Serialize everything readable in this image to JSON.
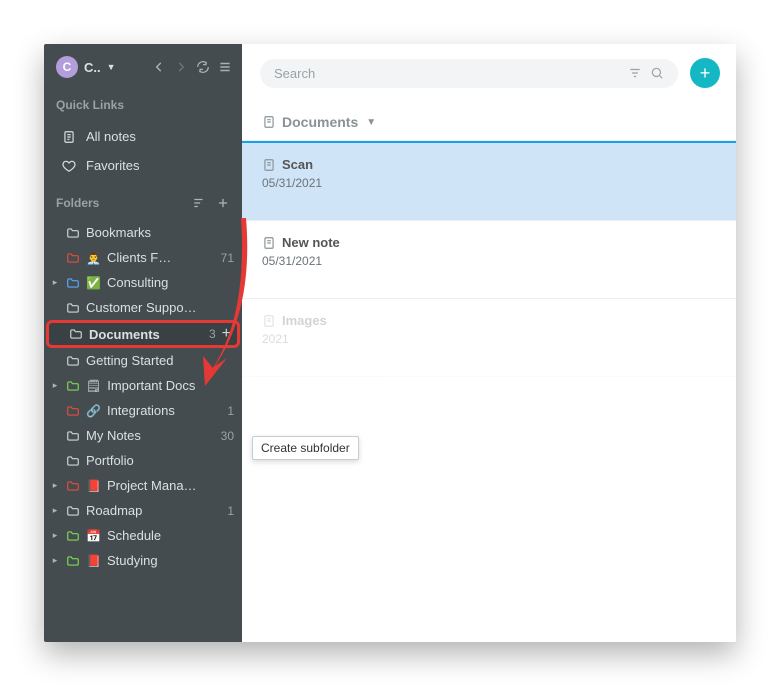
{
  "user": {
    "initial": "C",
    "name": "C.."
  },
  "quick_links": {
    "section_title": "Quick Links",
    "all_notes": "All notes",
    "favorites": "Favorites"
  },
  "folders_section": {
    "title": "Folders"
  },
  "folders": [
    {
      "label": "Bookmarks",
      "color": "#cfd6d9",
      "count": "",
      "expandable": false,
      "emoji": "",
      "highlight": false
    },
    {
      "label": "Clients F…",
      "color": "#e74c3c",
      "count": "71",
      "expandable": false,
      "emoji": "👨‍💼",
      "highlight": false
    },
    {
      "label": "Consulting",
      "color": "#56a8ff",
      "count": "",
      "expandable": true,
      "emoji": "✅",
      "highlight": false
    },
    {
      "label": "Customer Suppo…",
      "color": "#cfd6d9",
      "count": "",
      "expandable": false,
      "emoji": "",
      "highlight": false
    },
    {
      "label": "Documents",
      "color": "#cfd6d9",
      "count": "3",
      "expandable": false,
      "emoji": "",
      "highlight": true,
      "active": true
    },
    {
      "label": "Getting Started",
      "color": "#cfd6d9",
      "count": "",
      "expandable": false,
      "emoji": "",
      "highlight": false
    },
    {
      "label": "Important Docs",
      "color": "#7ed957",
      "count": "",
      "expandable": true,
      "emoji": "🗒",
      "highlight": false
    },
    {
      "label": "Integrations",
      "color": "#e74c3c",
      "count": "1",
      "expandable": false,
      "emoji": "🔗",
      "highlight": false
    },
    {
      "label": "My Notes",
      "color": "#cfd6d9",
      "count": "30",
      "expandable": false,
      "emoji": "",
      "highlight": false
    },
    {
      "label": "Portfolio",
      "color": "#cfd6d9",
      "count": "",
      "expandable": false,
      "emoji": "",
      "highlight": false
    },
    {
      "label": "Project Mana…",
      "color": "#e74c3c",
      "count": "",
      "expandable": true,
      "emoji": "📕",
      "highlight": false
    },
    {
      "label": "Roadmap",
      "color": "#cfd6d9",
      "count": "1",
      "expandable": true,
      "emoji": "",
      "highlight": false
    },
    {
      "label": "Schedule",
      "color": "#7ed957",
      "count": "",
      "expandable": true,
      "emoji": "📅",
      "highlight": false
    },
    {
      "label": "Studying",
      "color": "#7ed957",
      "count": "",
      "expandable": true,
      "emoji": "📕",
      "highlight": false
    }
  ],
  "search": {
    "placeholder": "Search"
  },
  "breadcrumb": {
    "label": "Documents"
  },
  "notes": [
    {
      "title": "Scan",
      "date": "05/31/2021",
      "selected": true
    },
    {
      "title": "New note",
      "date": "05/31/2021",
      "selected": false
    },
    {
      "title": "Images",
      "date": "2021",
      "selected": false,
      "dimmed": true
    }
  ],
  "tooltip": "Create subfolder",
  "icons": {
    "plus": "+"
  }
}
